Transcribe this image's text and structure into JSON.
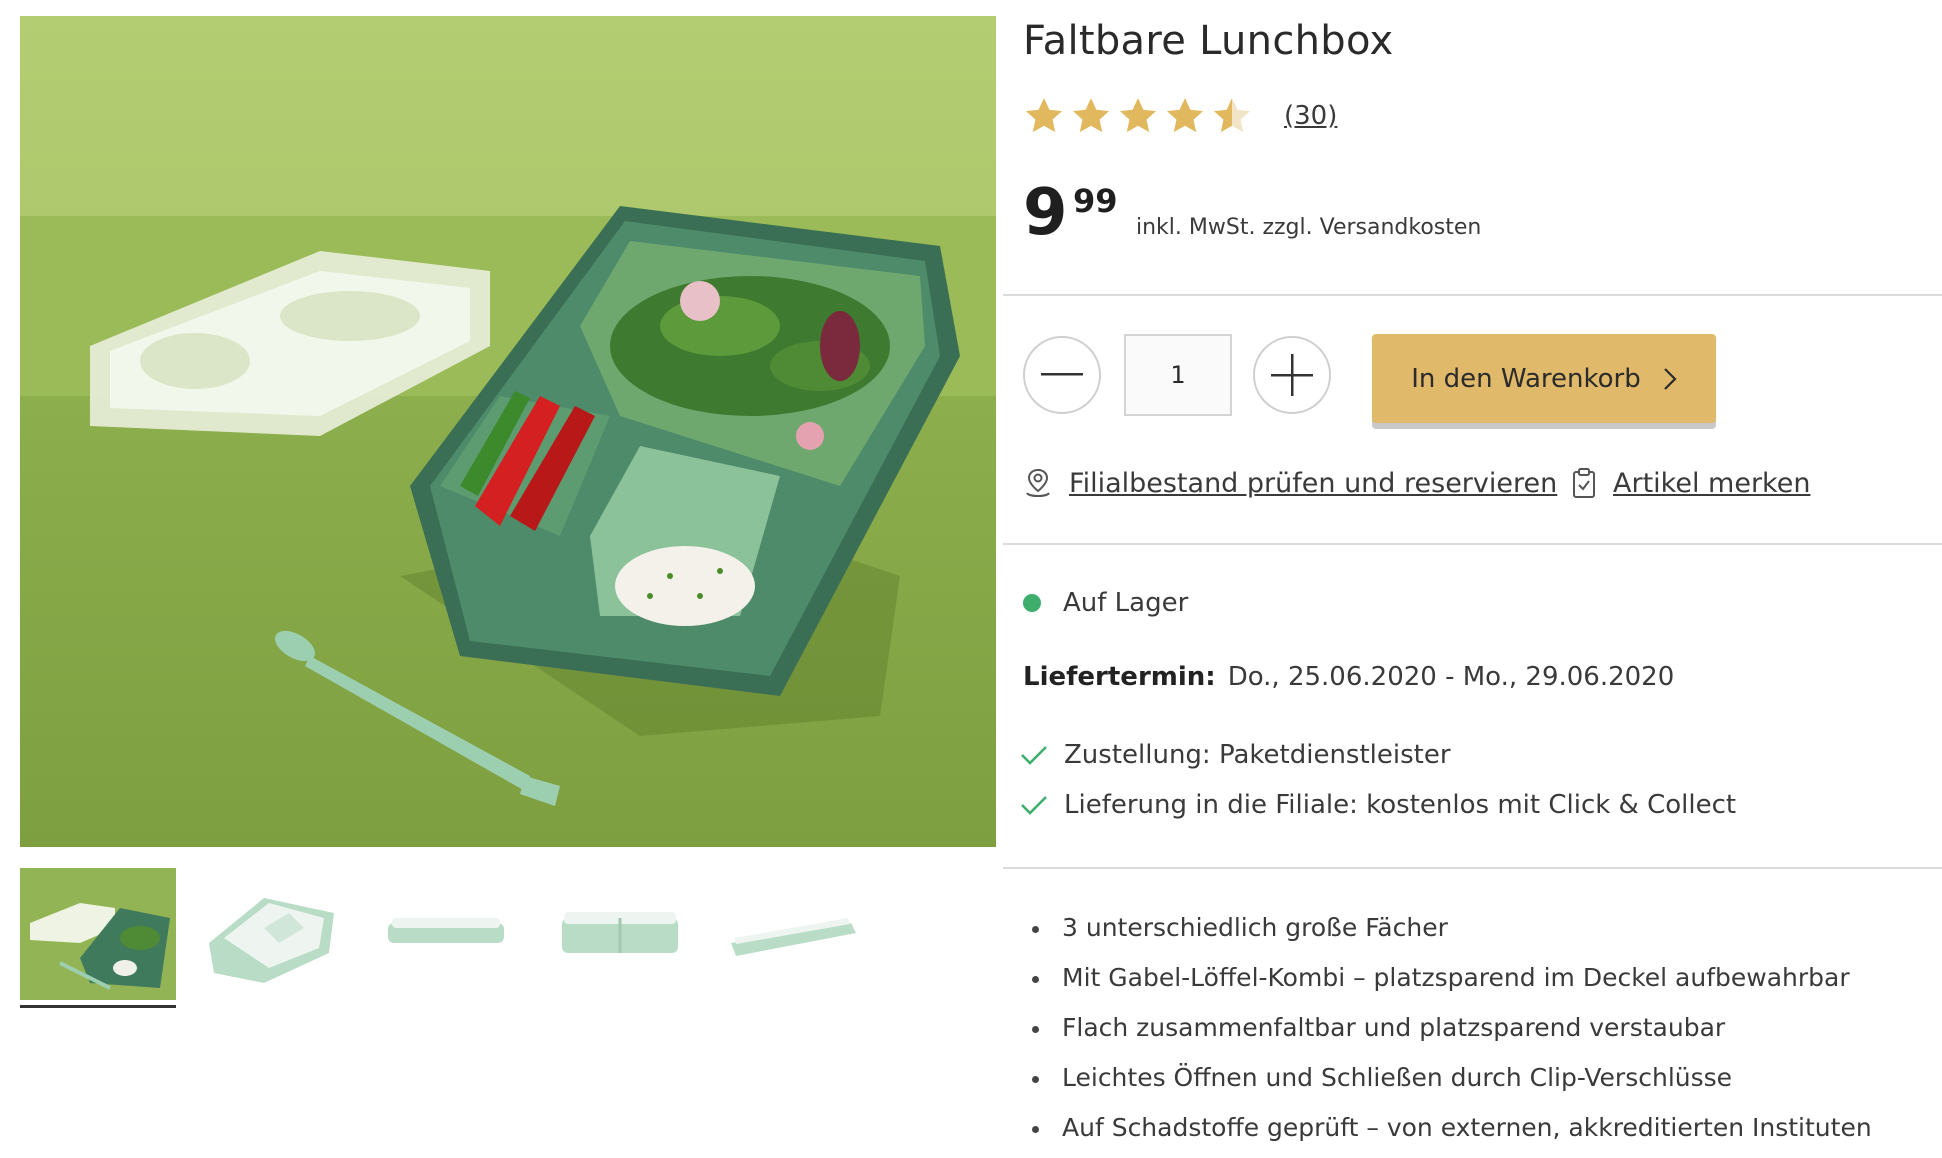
{
  "product": {
    "title": "Faltbare Lunchbox",
    "rating": 4.5,
    "rating_max": 5,
    "review_count": "(30)",
    "price_integer": "9",
    "price_decimal": "99",
    "price_note": "inkl. MwSt. zzgl. Versandkosten"
  },
  "gallery": {
    "main_image": "Lunchbox mit Salat, Paprika und Dip auf grünem Hintergrund",
    "thumbnail_count": 5,
    "active_thumbnail": 1
  },
  "cart": {
    "quantity": "1",
    "add_label": "In den Warenkorb"
  },
  "actions": {
    "store_check": "Filialbestand prüfen und reservieren",
    "save_item": "Artikel merken"
  },
  "availability": {
    "stock": "Auf Lager",
    "stock_color": "#3fae6c",
    "delivery_label": "Liefertermin:",
    "delivery_dates": "Do., 25.06.2020 - Mo., 29.06.2020",
    "shipping": [
      "Zustellung: Paketdienstleister",
      "Lieferung in die Filiale: kostenlos mit Click & Collect"
    ]
  },
  "features": [
    "3 unterschiedlich große Fächer",
    "Mit Gabel-Löffel-Kombi – platzsparend im Deckel aufbewahrbar",
    "Flach zusammenfaltbar und platzsparend verstaubar",
    "Leichtes Öffnen und Schließen durch Clip-Verschlüsse",
    "Auf Schadstoffe geprüft – von externen, akkreditierten Instituten"
  ],
  "colors": {
    "accent": "#e0b96a",
    "star": "#e2b85e",
    "check": "#3fae6c",
    "box_green": "#3f7a5c",
    "background_green": "#8fb24f"
  },
  "icons": [
    "minus-icon",
    "plus-icon",
    "chevron-right-icon",
    "store-location-icon",
    "clipboard-icon",
    "check-icon",
    "star-icon"
  ]
}
